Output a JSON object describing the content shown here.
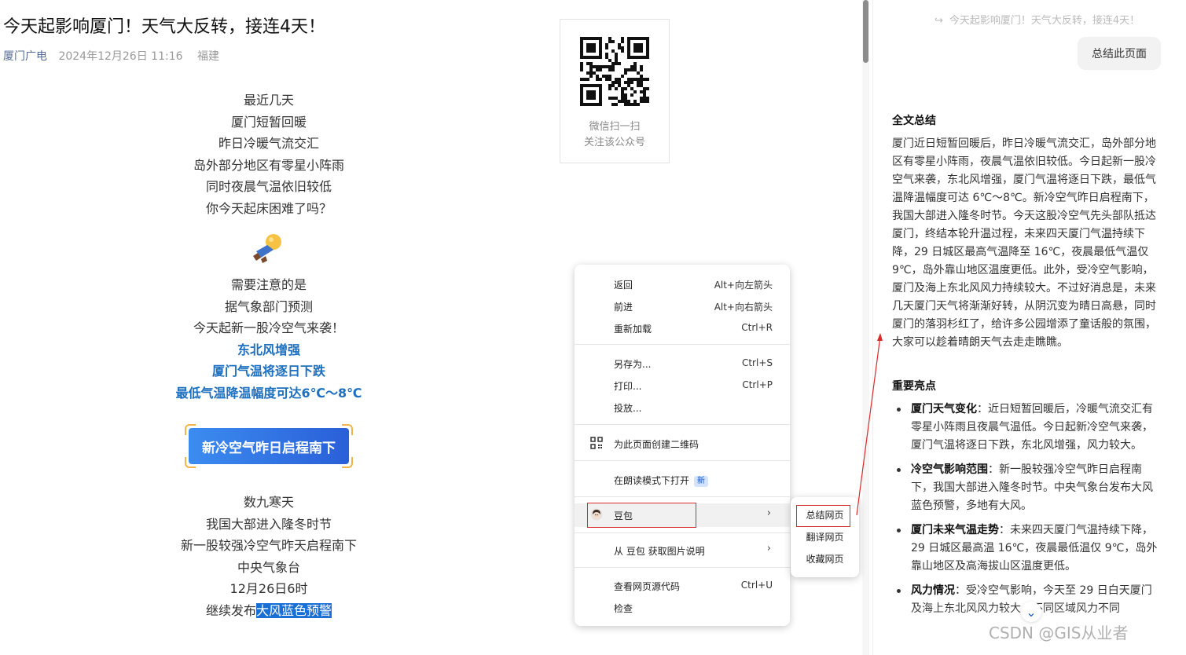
{
  "article": {
    "title": "今天起影响厦门！天气大反转，接连4天！",
    "source": "厦门广电",
    "date": "2024年12月26日 11:16",
    "location": "福建",
    "lines1": [
      "最近几天",
      "厦门短暂回暖",
      "昨日冷暖气流交汇",
      "岛外部分地区有零星小阵雨",
      "同时夜晨气温依旧较低",
      "你今天起床困难了吗？"
    ],
    "lines2": [
      "需要注意的是",
      "据气象部门预测",
      "今天起新一股冷空气来袭！"
    ],
    "highlights": [
      "东北风增强",
      "厦门气温将逐日下跌",
      "最低气温降温幅度可达6℃～8℃"
    ],
    "cta": "新冷空气昨日启程南下",
    "lines3": [
      "数九寒天",
      "我国大部进入隆冬时节",
      "新一股较强冷空气昨天启程南下",
      "中央气象台",
      "12月26日6时"
    ],
    "last_prefix": "继续发布",
    "last_mark": "大风蓝色预警"
  },
  "qr": {
    "line1": "微信扫一扫",
    "line2": "关注该公众号"
  },
  "context_menu": {
    "back": "返回",
    "back_sc": "Alt+向左箭头",
    "forward": "前进",
    "forward_sc": "Alt+向右箭头",
    "reload": "重新加载",
    "reload_sc": "Ctrl+R",
    "save": "另存为...",
    "save_sc": "Ctrl+S",
    "print": "打印...",
    "print_sc": "Ctrl+P",
    "cast": "投放...",
    "qrcode": "为此页面创建二维码",
    "reader": "在朗读模式下打开",
    "reader_badge": "新",
    "doubao": "豆包",
    "img_desc": "从 豆包 获取图片说明",
    "view_source": "查看网页源代码",
    "view_source_sc": "Ctrl+U",
    "inspect": "检查"
  },
  "submenu": {
    "summarize": "总结网页",
    "translate": "翻译网页",
    "bookmark": "收藏网页"
  },
  "side_panel": {
    "query_title": "今天起影响厦门！天气大反转，接连4天！",
    "query_button": "总结此页面",
    "summary_heading": "全文总结",
    "summary": "厦门近日短暂回暖后，昨日冷暖气流交汇，岛外部分地区有零星小阵雨，夜晨气温依旧较低。今日起新一股冷空气来袭，东北风增强，厦门气温将逐日下跌，最低气温降温幅度可达 6℃～8℃。新冷空气昨日启程南下，我国大部进入隆冬时节。今天这股冷空气先头部队抵达厦门，终结本轮升温过程，未来四天厦门气温持续下降，29 日城区最高气温降至 16℃，夜晨最低气温仅 9℃，岛外靠山地区温度更低。此外，受冷空气影响，厦门及海上东北风风力持续较大。不过好消息是，未来几天厦门天气将渐渐好转，从阴沉变为晴日高悬，同时厦门的落羽杉红了，给许多公园增添了童话般的氛围，大家可以趁着晴朗天气去走走瞧瞧。",
    "highlights_heading": "重要亮点",
    "highlights": [
      {
        "title": "厦门天气变化",
        "text": "：近日短暂回暖后，冷暖气流交汇有零星小阵雨且夜晨气温低。今日起新冷空气来袭，厦门气温将逐日下跌，东北风增强，风力较大。"
      },
      {
        "title": "冷空气影响范围",
        "text": "：新一股较强冷空气昨日启程南下，我国大部进入隆冬时节。中央气象台发布大风蓝色预警，多地有大风。"
      },
      {
        "title": "厦门未来气温走势",
        "text": "：未来四天厦门气温持续下降，29 日城区最高温 16℃，夜晨最低温仅 9℃，岛外靠山地区及高海拔山区温度更低。"
      },
      {
        "title": "风力情况",
        "text": "：受冷空气影响，今天至 29 日白天厦门及海上东北风风力较大，不同区域风力不同"
      }
    ]
  },
  "watermark": "CSDN @GIS从业者",
  "colors": {
    "accent": "#1d6fbf",
    "annotation_red": "#d92b2b",
    "cta_start": "#3b8cf0",
    "cta_end": "#2a5fd8"
  }
}
